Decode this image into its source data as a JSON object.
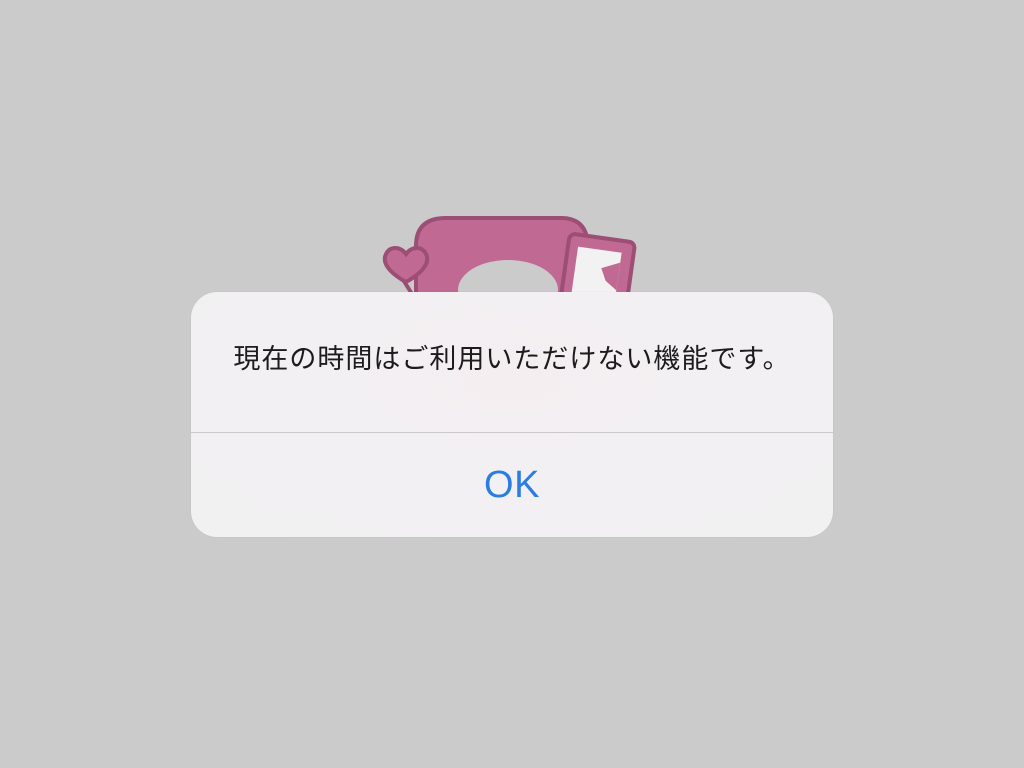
{
  "background": {
    "color": "#cbcbcb"
  },
  "app_logo": {
    "icon": "app-logo-with-heart-and-card",
    "color": "#c06a93",
    "outline_color": "#9c4e74"
  },
  "alert": {
    "message": "現在の時間はご利用いただけない機能です。",
    "ok_label": "OK",
    "button_color": "#2a7de1"
  }
}
